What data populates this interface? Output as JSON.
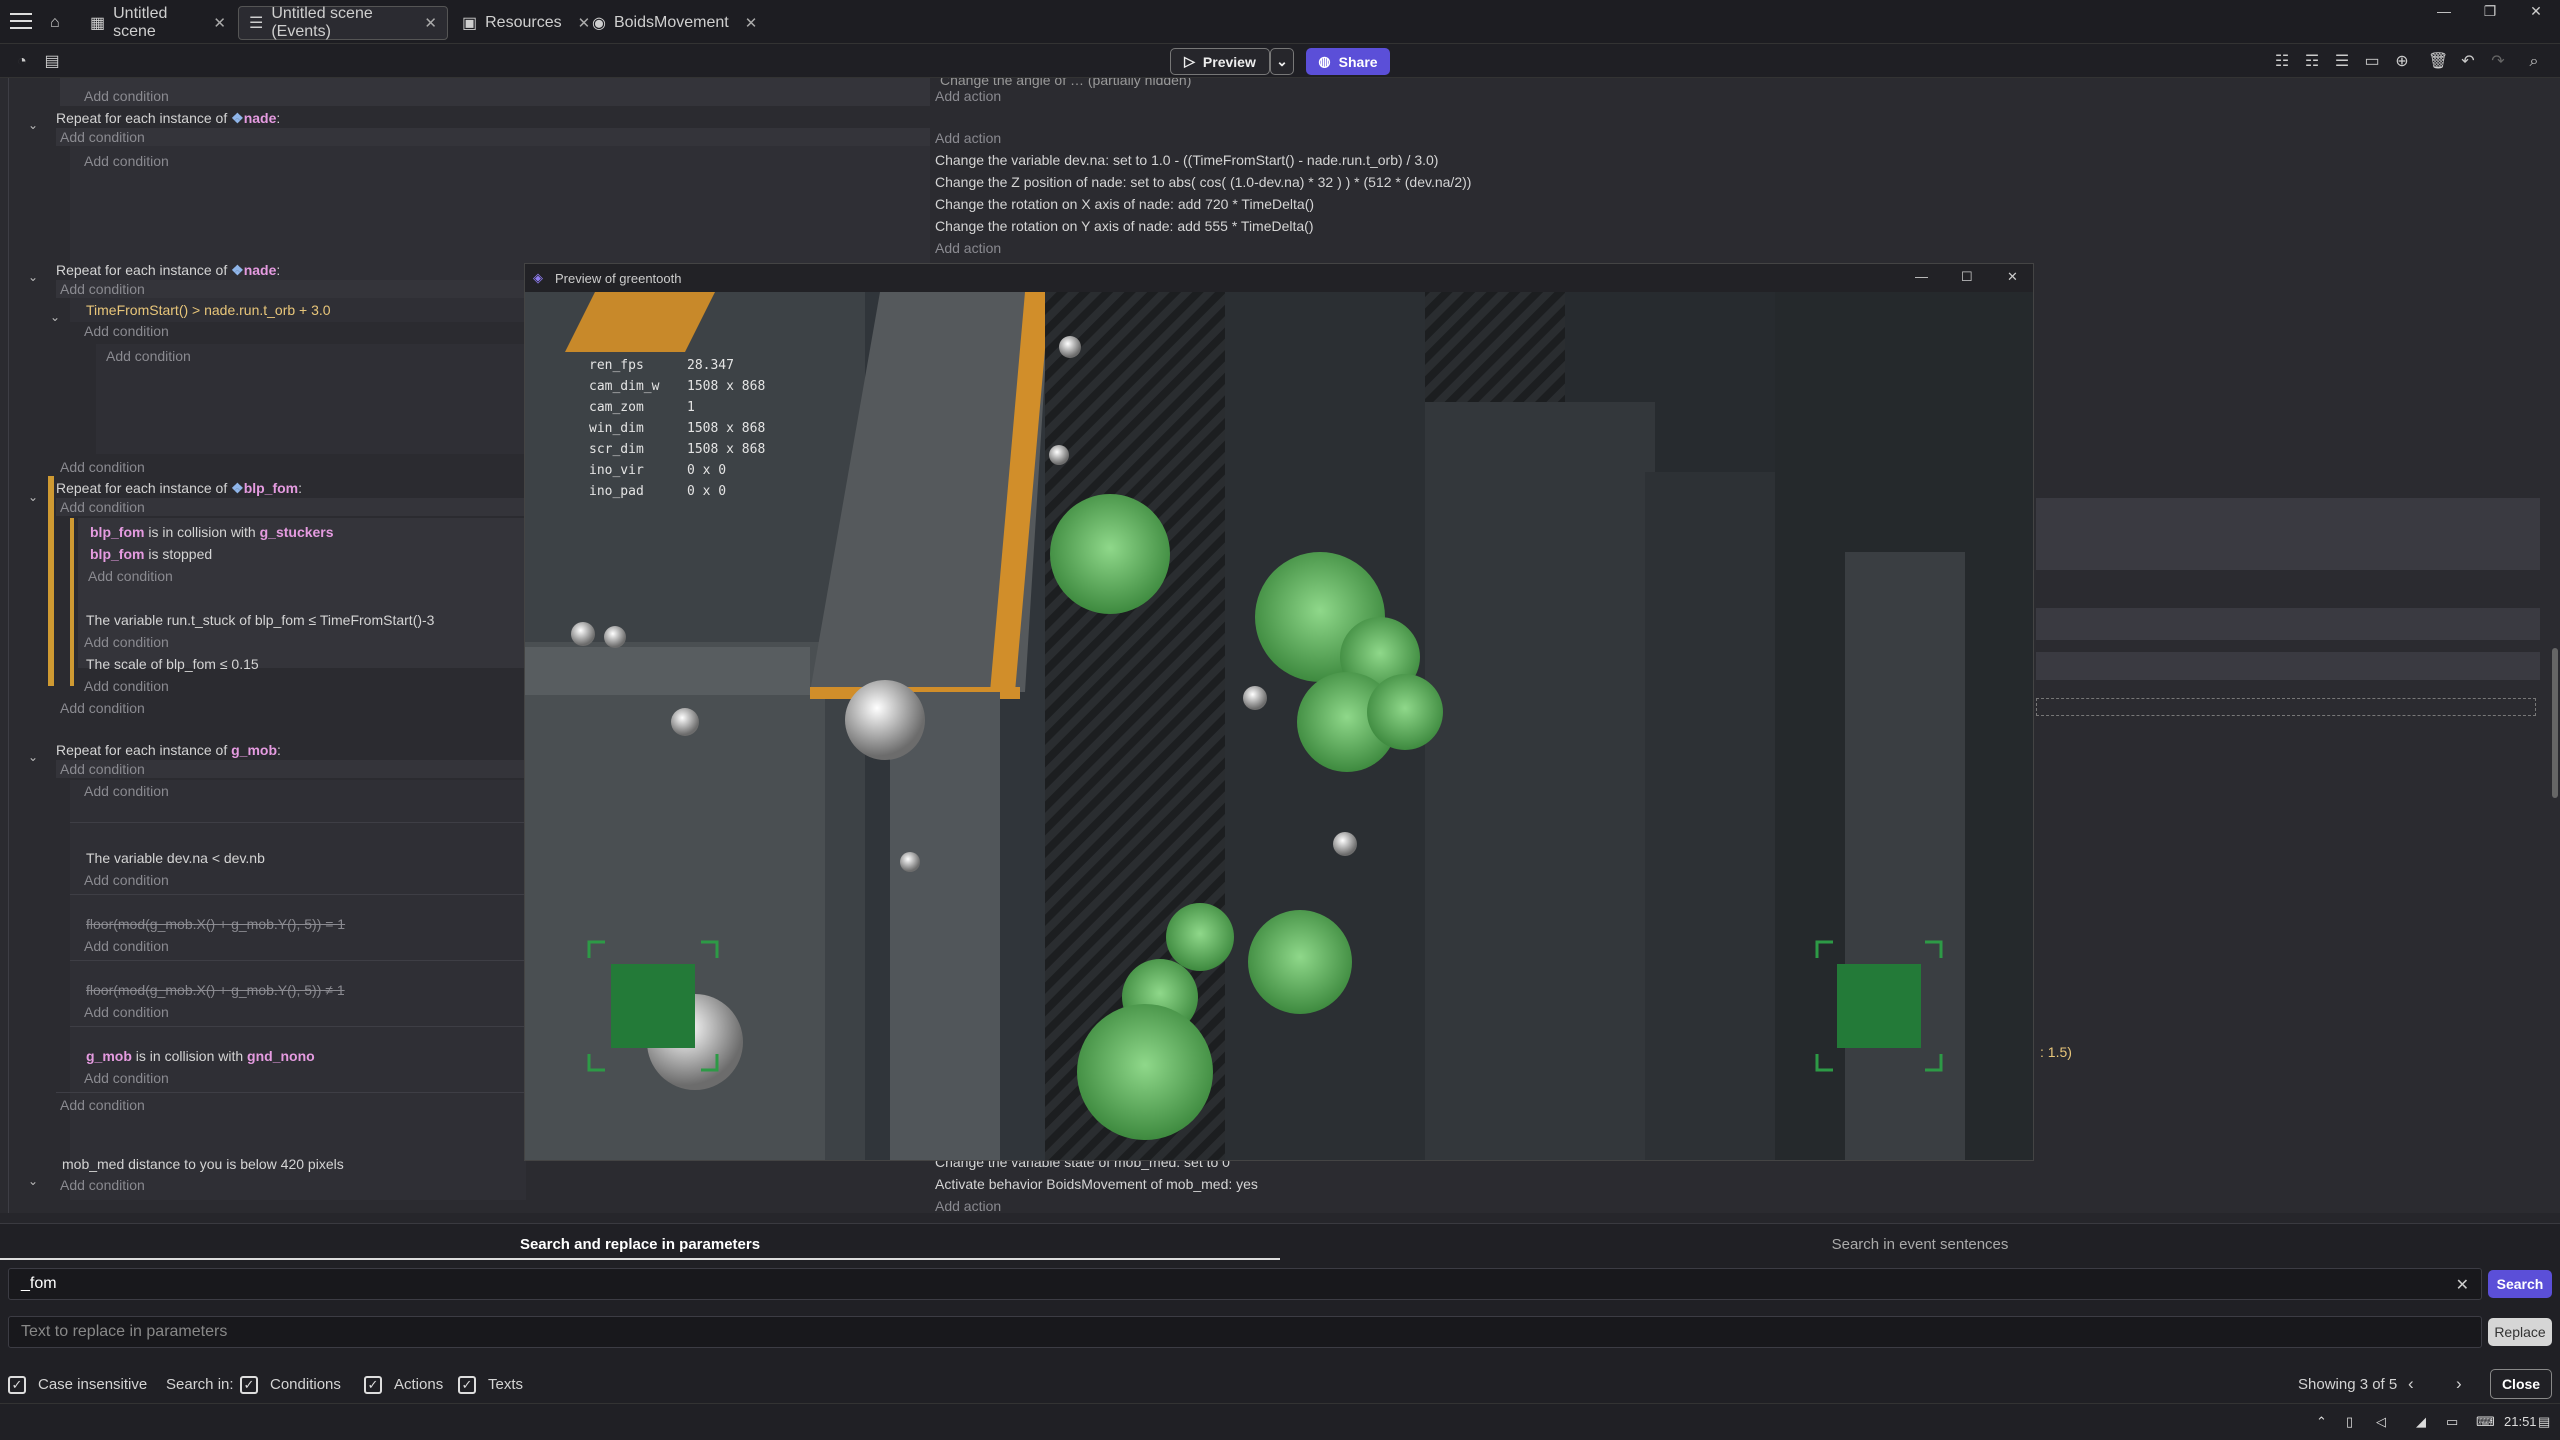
{
  "tabs": [
    {
      "label": "Untitled scene",
      "icon": "scene-icon"
    },
    {
      "label": "Untitled scene (Events)",
      "icon": "events-icon"
    },
    {
      "label": "Resources",
      "icon": "resources-icon"
    },
    {
      "label": "BoidsMovement",
      "icon": "behavior-icon"
    }
  ],
  "toolbar": {
    "preview_label": "Preview",
    "share_label": "Share"
  },
  "events": {
    "top_action": "Change the angle of … (partially hidden)",
    "add_condition": "Add condition",
    "add_action": "Add action",
    "repeat_prefix": "Repeat for each instance of",
    "obj_nade": "nade",
    "obj_blp_fom": "blp_fom",
    "obj_g_mob": "g_mob",
    "e1_actions": [
      "Change the variable dev.na: set to 1.0 - ((TimeFromStart() - nade.run.t_orb) / 3.0)",
      "Change the Z position of nade: set to abs( cos( (1.0-dev.na) * 32 ) ) * (512 * (dev.na/2))",
      "Change the rotation on X axis of nade: add 720 * TimeDelta()",
      "Change the rotation on Y axis of nade: add 555 * TimeDelta()"
    ],
    "e2_cond": "TimeFromStart() > nade.run.t_orb + 3.0",
    "e3_cond1_obj": "blp_fom",
    "e3_cond1_text": "is in collision with",
    "e3_cond1_target": "g_stuckers",
    "e3_cond2_obj": "blp_fom",
    "e3_cond2_text": "is stopped",
    "e3_cond3": "The variable run.t_stuck of blp_fom ≤ TimeFromStart()-3",
    "e3_cond4": "The scale of blp_fom ≤ 0.15",
    "e4_cond1": "The variable dev.na < dev.nb",
    "e4_cond2": "floor(mod(g_mob.X() + g_mob.Y(), 5)) = 1",
    "e4_cond3": "floor(mod(g_mob.X() + g_mob.Y(), 5)) ≠ 1",
    "e4_cond4_obj": "g_mob",
    "e4_cond4_text": "is in collision with",
    "e4_cond4_target": "gnd_nono",
    "e5_cond": "mob_med distance to you is below 420 pixels",
    "e5_actions": [
      "Change the variable state of mob_med: set to 0",
      "Activate behavior BoidsMovement of mob_med: yes"
    ],
    "side_value": ": 1.5)"
  },
  "preview": {
    "title": "Preview of greentooth",
    "debug": [
      {
        "k": "ren_fps",
        "v": "28.347"
      },
      {
        "k": "cam_dim_w",
        "v": "1508 x 868"
      },
      {
        "k": "cam_zom",
        "v": "1"
      },
      {
        "k": "win_dim",
        "v": "1508 x 868"
      },
      {
        "k": "scr_dim",
        "v": "1508 x 868"
      },
      {
        "k": "ino_vir",
        "v": "0 x 0"
      },
      {
        "k": "ino_pad",
        "v": "0 x 0"
      }
    ]
  },
  "search": {
    "tab_params": "Search and replace in parameters",
    "tab_sentences": "Search in event sentences",
    "query": "_fom",
    "replace_placeholder": "Text to replace in parameters",
    "search_button": "Search",
    "replace_button": "Replace",
    "case_label": "Case insensitive",
    "search_in": "Search in:",
    "conditions": "Conditions",
    "actions": "Actions",
    "texts": "Texts",
    "showing": "Showing 3 of 5",
    "close": "Close"
  },
  "taskbar": {
    "time": "21:51"
  },
  "colors": {
    "accent": "#5b4fd8",
    "object": "#e59be0",
    "value": "#e8c67a",
    "highlight": "#cf9a32"
  }
}
